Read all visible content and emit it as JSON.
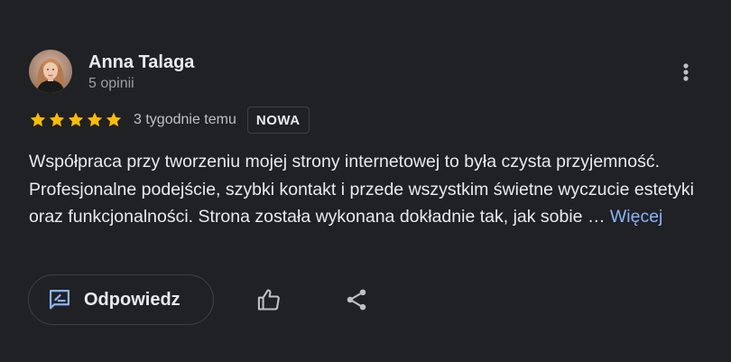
{
  "review": {
    "author": {
      "name": "Anna Talaga",
      "review_count": "5 opinii",
      "avatar_icon": "avatar-photo"
    },
    "rating": {
      "stars": 5,
      "max_stars": 5,
      "star_color": "#fbbc04"
    },
    "date": "3 tygodnie temu",
    "badge": "NOWA",
    "text": "Współpraca przy tworzeniu mojej strony internetowej to była czysta przyjemność. Profesjonalne podejście, szybki kontakt i przede wszystkim świetne wyczucie estetyki oraz funkcjonalności. Strona została wykonana dokładnie tak, jak sobie … ",
    "more_link": "Więcej"
  },
  "actions": {
    "reply_label": "Odpowiedz",
    "reply_icon": "rate-review-icon",
    "like_icon": "thumb-up-icon",
    "share_icon": "share-icon",
    "more_icon": "more-vert-icon"
  },
  "colors": {
    "background": "#202124",
    "text_primary": "#e8eaed",
    "text_secondary": "#9aa0a6",
    "link": "#8ab4f8",
    "border": "#3c4043",
    "icon": "#bdc1c6"
  }
}
